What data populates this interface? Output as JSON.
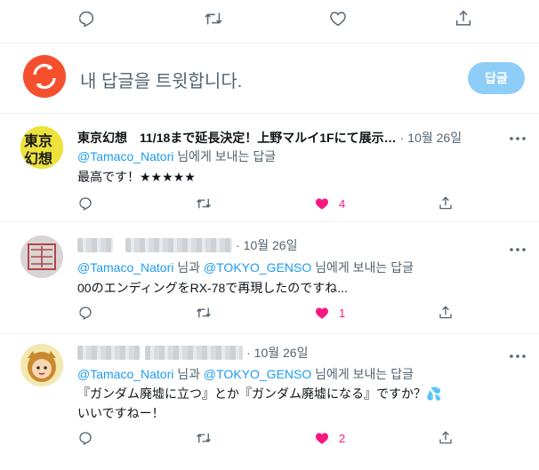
{
  "top_actions": {
    "reply_icon": "reply-icon",
    "retweet_icon": "retweet-icon",
    "like_icon": "like-icon",
    "share_icon": "share-icon"
  },
  "reply_box": {
    "prompt": "내 답글을 트윗합니다.",
    "button_label": "답글"
  },
  "tweets": [
    {
      "name": "東京幻想　11/18まで延長決定！上野マルイ1Fにて展示…",
      "separator": "·",
      "date": "10월 26일",
      "reply_mention_1": "@Tamaco_Natori",
      "reply_join": "",
      "reply_mention_2": "",
      "reply_suffix": "님에게 보내는 답글",
      "text_lines": [
        "最高です！★★★★★"
      ],
      "like_count": "4",
      "liked": true
    },
    {
      "name": "",
      "separator": "·",
      "date": "10월 26일",
      "reply_mention_1": "@Tamaco_Natori",
      "reply_join": "님과",
      "reply_mention_2": "@TOKYO_GENSO",
      "reply_suffix": "님에게 보내는 답글",
      "text_lines": [
        "00のエンディングをRX-78で再現したのですね..."
      ],
      "like_count": "1",
      "liked": true
    },
    {
      "name": "",
      "separator": "·",
      "date": "10월 26일",
      "reply_mention_1": "@Tamaco_Natori",
      "reply_join": "님과",
      "reply_mention_2": "@TOKYO_GENSO",
      "reply_suffix": "님에게 보내는 답글",
      "text_lines": [
        "『ガンダム廃墟に立つ』とか『ガンダム廃墟になる』ですか？💦",
        "いいですねー！"
      ],
      "like_count": "2",
      "liked": true
    }
  ],
  "colors": {
    "accent": "#1d9bf0",
    "like": "#f91880",
    "muted": "#536471",
    "button_disabled": "#8ecdf8",
    "avatar_mine": "#f4502d"
  }
}
